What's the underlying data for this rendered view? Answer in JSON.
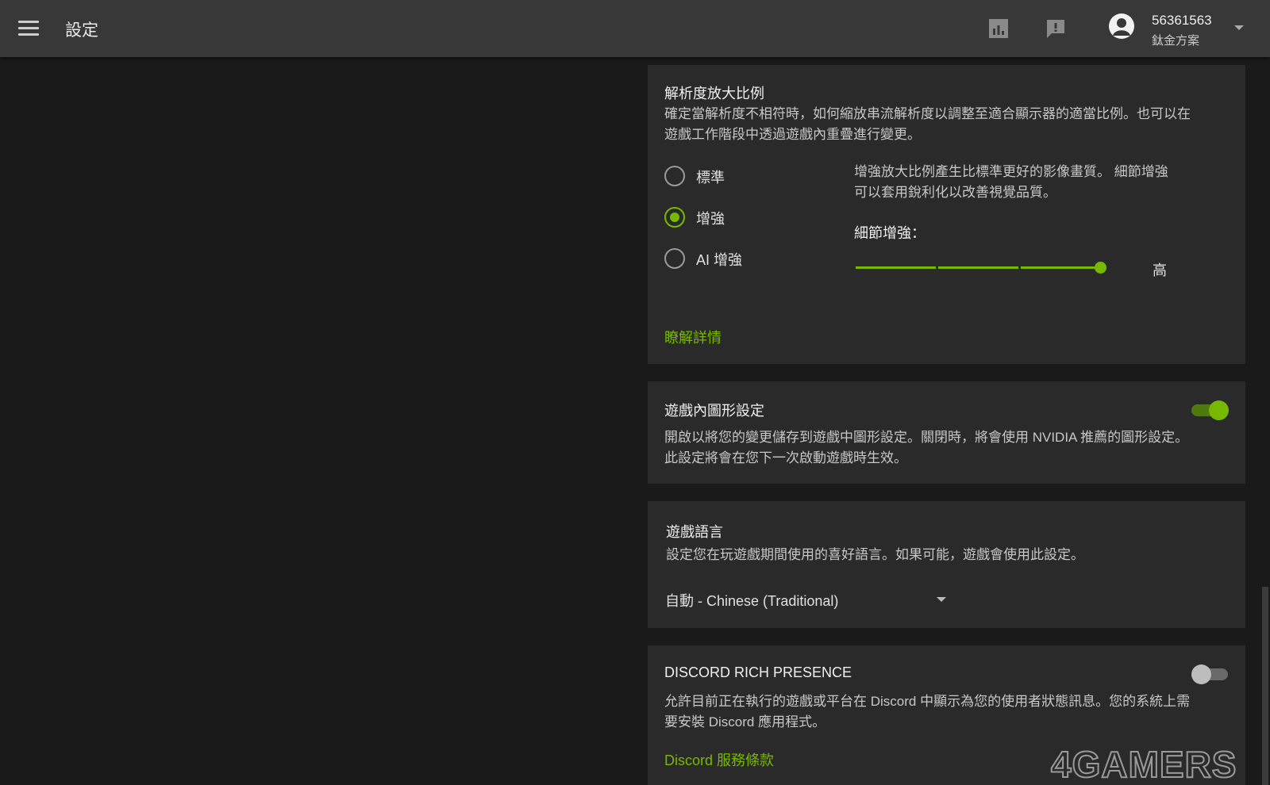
{
  "header": {
    "title": "設定",
    "user_id": "56361563",
    "user_plan": "鈦金方案"
  },
  "icons": {
    "menu": "hamburger-menu-icon",
    "performance": "performance-chart-icon",
    "feedback": "feedback-icon",
    "avatar": "user-avatar-icon",
    "dropdown": "chevron-down-icon"
  },
  "colors": {
    "accent": "#76b900",
    "background": "#1a1a1a",
    "card": "#2a2a2a",
    "topbar": "#383838"
  },
  "upscaling": {
    "title": "解析度放大比例",
    "description_1": "確定當解析度不相符時，如何縮放串流解析度以調整至適合顯示器的適當比例。也可以在",
    "description_2": "遊戲工作階段中透過遊戲內重疊進行變更。",
    "options": [
      {
        "label": "標準",
        "selected": false
      },
      {
        "label": "增強",
        "selected": true
      },
      {
        "label": "AI 增強",
        "selected": false
      }
    ],
    "enhanced_desc_1": "增強放大比例產生比標準更好的影像畫質。 細節增強",
    "enhanced_desc_2": "可以套用銳利化以改善視覺品質。",
    "detail_label": "細節增強：",
    "slider_level": "高",
    "slider_value_fraction": 1.0,
    "learn_more": "瞭解詳情"
  },
  "ingame_graphics": {
    "title": "遊戲內圖形設定",
    "enabled": true,
    "description_1": "開啟以將您的變更儲存到遊戲中圖形設定。關閉時，將會使用 NVIDIA 推薦的圖形設定。",
    "description_2": "此設定將會在您下一次啟動遊戲時生效。"
  },
  "game_language": {
    "title": "遊戲語言",
    "description": "設定您在玩遊戲期間使用的喜好語言。如果可能，遊戲會使用此設定。",
    "selected": "自動 - Chinese (Traditional)"
  },
  "discord": {
    "title": "DISCORD RICH PRESENCE",
    "enabled": false,
    "description_1": "允許目前正在執行的遊戲或平台在 Discord 中顯示為您的使用者狀態訊息。您的系統上需",
    "description_2": "要安裝 Discord 應用程式。",
    "link": "Discord 服務條款"
  },
  "watermark": "4GAMERS"
}
